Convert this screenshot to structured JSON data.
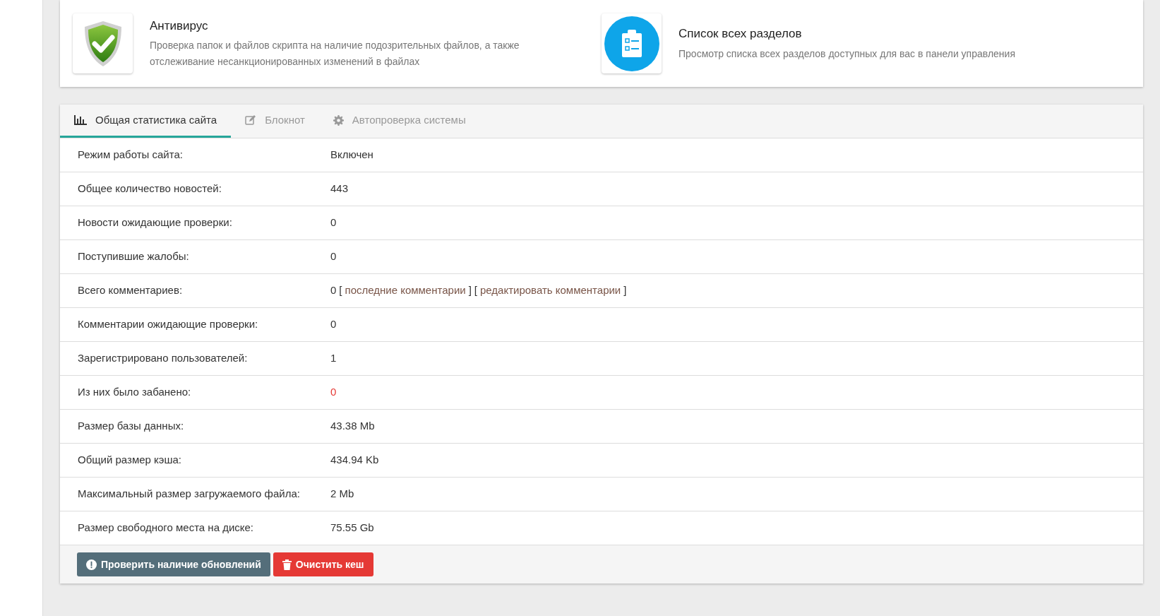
{
  "shortcuts": [
    {
      "kind": "shield",
      "title": "Антивирус",
      "description": "Проверка папок и файлов скрипта на наличие подозрительных файлов, а также отслеживание несанкционированных изменений в файлах"
    },
    {
      "kind": "clipboard",
      "title": "Список всех разделов",
      "description": "Просмотр списка всех разделов доступных для вас в панели управления"
    }
  ],
  "tabs": [
    {
      "label": "Общая статистика сайта",
      "selected": true
    },
    {
      "label": "Блокнот",
      "selected": false
    },
    {
      "label": "Автопроверка системы",
      "selected": false
    }
  ],
  "rows": [
    {
      "label": "Режим работы сайта:",
      "value": "Включен",
      "alert": false
    },
    {
      "label": "Общее количество новостей:",
      "value": "443",
      "alert": false
    },
    {
      "label": "Новости ожидающие проверки:",
      "value": "0",
      "alert": false
    },
    {
      "label": "Поступившие жалобы:",
      "value": "0",
      "alert": false
    },
    {
      "label": "Всего комментариев:",
      "value": "0",
      "alert": false,
      "links": [
        {
          "open": "[",
          "text": "последние комментарии",
          "close": "]"
        },
        {
          "open": "[",
          "text": "редактировать комментарии",
          "close": "]"
        }
      ]
    },
    {
      "label": "Комментарии ожидающие проверки:",
      "value": "0",
      "alert": false
    },
    {
      "label": "Зарегистрировано пользователей:",
      "value": "1",
      "alert": false
    },
    {
      "label": "Из них было забанено:",
      "value": "0",
      "alert": true
    },
    {
      "label": "Размер базы данных:",
      "value": "43.38 Mb",
      "alert": false
    },
    {
      "label": "Общий размер кэша:",
      "value": "434.94 Kb",
      "alert": false
    },
    {
      "label": "Максимальный размер загружаемого файла:",
      "value": "2 Mb",
      "alert": false
    },
    {
      "label": "Размер свободного места на диске:",
      "value": "75.55 Gb",
      "alert": false
    }
  ],
  "buttons": [
    {
      "kind": "info",
      "label": "Проверить наличие обновлений"
    },
    {
      "kind": "danger",
      "label": "Очистить кеш"
    }
  ]
}
